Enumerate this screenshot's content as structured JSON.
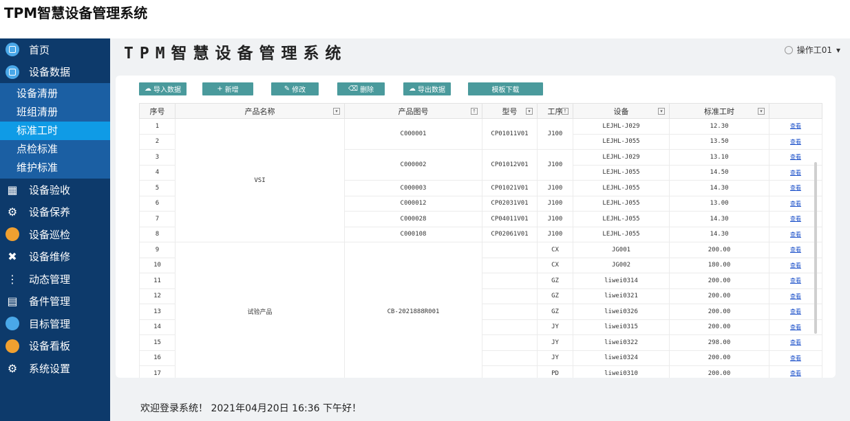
{
  "page_caption": "TPM智慧设备管理系统",
  "sidebar": {
    "items": [
      {
        "label": "首页",
        "icon": "home-icon"
      },
      {
        "label": "设备数据",
        "icon": "monitor-icon"
      },
      {
        "label": "设备验收",
        "icon": "clipboard-icon"
      },
      {
        "label": "设备保养",
        "icon": "wrench-icon"
      },
      {
        "label": "设备巡检",
        "icon": "clipboard-round-icon"
      },
      {
        "label": "设备维修",
        "icon": "tools-icon"
      },
      {
        "label": "动态管理",
        "icon": "share-icon"
      },
      {
        "label": "备件管理",
        "icon": "inventory-icon"
      },
      {
        "label": "目标管理",
        "icon": "target-icon"
      },
      {
        "label": "设备看板",
        "icon": "dashboard-icon"
      },
      {
        "label": "系统设置",
        "icon": "gear-icon"
      }
    ],
    "submenu": [
      "设备清册",
      "班组清册",
      "标准工时",
      "点检标准",
      "维护标准"
    ],
    "active_sub": "标准工时"
  },
  "header": {
    "system_title": "TPM智慧设备管理系统",
    "user": "操作工01"
  },
  "toolbar": {
    "import": "导入数据",
    "add": "新增",
    "edit": "修改",
    "delete": "删除",
    "export": "导出数据",
    "template": "模板下载"
  },
  "table": {
    "headers": [
      "序号",
      "产品名称",
      "产品图号",
      "型号",
      "工序",
      "设备",
      "标准工时"
    ],
    "action_label": "查看",
    "rows": [
      {
        "no": "1",
        "name": "VSI",
        "drawing": "C000001",
        "model": "CP01011V01",
        "process": "J100",
        "device": "LEJHL-J029",
        "hours": "12.30"
      },
      {
        "no": "2",
        "name": "VSI",
        "drawing": "C000001",
        "model": "CP01011V01",
        "process": "J100",
        "device": "LEJHL-J055",
        "hours": "13.50"
      },
      {
        "no": "3",
        "name": "VSI",
        "drawing": "C000002",
        "model": "CP01012V01",
        "process": "J100",
        "device": "LEJHL-J029",
        "hours": "13.10"
      },
      {
        "no": "4",
        "name": "VSI",
        "drawing": "C000002",
        "model": "CP01012V01",
        "process": "J100",
        "device": "LEJHL-J055",
        "hours": "14.50"
      },
      {
        "no": "5",
        "name": "VSI",
        "drawing": "C000003",
        "model": "CP01021V01",
        "process": "J100",
        "device": "LEJHL-J055",
        "hours": "14.30"
      },
      {
        "no": "6",
        "name": "VSI",
        "drawing": "C000012",
        "model": "CP02031V01",
        "process": "J100",
        "device": "LEJHL-J055",
        "hours": "13.00"
      },
      {
        "no": "7",
        "name": "VSI",
        "drawing": "C000028",
        "model": "CP04011V01",
        "process": "J100",
        "device": "LEJHL-J055",
        "hours": "14.30"
      },
      {
        "no": "8",
        "name": "VSI",
        "drawing": "C000108",
        "model": "CP02061V01",
        "process": "J100",
        "device": "LEJHL-J055",
        "hours": "14.30"
      },
      {
        "no": "9",
        "name": "试验产品",
        "drawing": "CB-2021888R001",
        "model": "",
        "process": "CX",
        "device": "JG001",
        "hours": "200.00"
      },
      {
        "no": "10",
        "name": "试验产品",
        "drawing": "CB-2021888R001",
        "model": "",
        "process": "CX",
        "device": "JG002",
        "hours": "180.00"
      },
      {
        "no": "11",
        "name": "试验产品",
        "drawing": "CB-2021888R001",
        "model": "",
        "process": "GZ",
        "device": "liwei0314",
        "hours": "200.00"
      },
      {
        "no": "12",
        "name": "试验产品",
        "drawing": "CB-2021888R001",
        "model": "",
        "process": "GZ",
        "device": "liwei0321",
        "hours": "200.00"
      },
      {
        "no": "13",
        "name": "试验产品",
        "drawing": "CB-2021888R001",
        "model": "",
        "process": "GZ",
        "device": "liwei0326",
        "hours": "200.00"
      },
      {
        "no": "14",
        "name": "试验产品",
        "drawing": "CB-2021888R001",
        "model": "",
        "process": "JY",
        "device": "liwei0315",
        "hours": "200.00"
      },
      {
        "no": "15",
        "name": "试验产品",
        "drawing": "CB-2021888R001",
        "model": "",
        "process": "JY",
        "device": "liwei0322",
        "hours": "298.00"
      },
      {
        "no": "16",
        "name": "试验产品",
        "drawing": "CB-2021888R001",
        "model": "",
        "process": "JY",
        "device": "liwei0324",
        "hours": "200.00"
      },
      {
        "no": "17",
        "name": "试验产品",
        "drawing": "CB-2021888R001",
        "model": "",
        "process": "PD",
        "device": "liwei0310",
        "hours": "200.00"
      }
    ]
  },
  "footer": {
    "welcome": "欢迎登录系统！ 2021年04月20日 16:36 下午好！"
  },
  "colors": {
    "sidebar_bg": "#0d3a6b",
    "submenu_bg": "#1b5fa3",
    "active_bg": "#0f9be6",
    "button_bg": "#4a9a9c"
  }
}
